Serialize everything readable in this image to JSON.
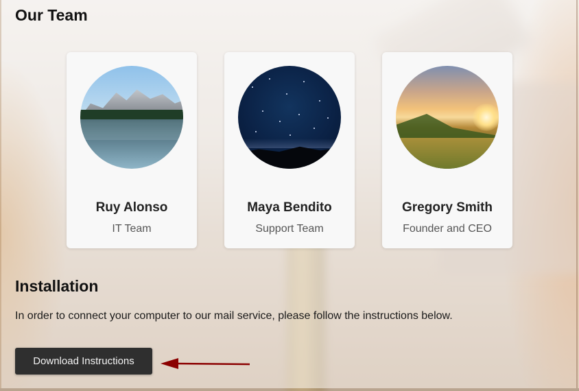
{
  "team": {
    "title": "Our Team",
    "members": [
      {
        "name": "Ruy Alonso",
        "role": "IT Team",
        "photo": "mountain-lake-photo"
      },
      {
        "name": "Maya Bendito",
        "role": "Support Team",
        "photo": "night-sky-photo"
      },
      {
        "name": "Gregory Smith",
        "role": "Founder and CEO",
        "photo": "sunset-valley-photo"
      }
    ]
  },
  "installation": {
    "title": "Installation",
    "text": "In order to connect your computer to our mail service, please follow the instructions below.",
    "button_label": "Download Instructions"
  },
  "annotation": {
    "arrow_color": "#8b0000",
    "arrow_icon": "left-arrow-icon"
  },
  "colors": {
    "button_bg": "#2f2f2f",
    "card_bg": "#f8f8f8"
  }
}
